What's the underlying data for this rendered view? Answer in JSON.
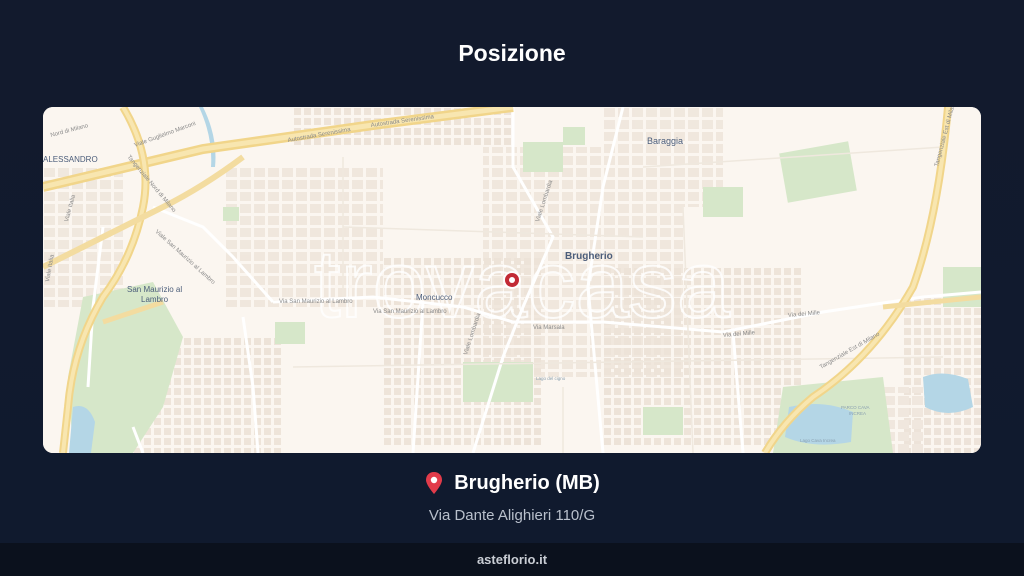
{
  "page": {
    "title": "Posizione"
  },
  "map": {
    "watermark": "trovacasa",
    "labels": {
      "alessandro": "ALESSANDRO",
      "baraggia": "Baraggia",
      "brugherio": "Brugherio",
      "moncucco": "Moncucco",
      "san_maurizio": "San Maurizio al",
      "san_maurizio_2": "Lambro",
      "parco": "PARCO CAVA",
      "parco_2": "INCREA",
      "lago_increa": "Lago Cava Increa",
      "lago_del_cigno": "Lago del cigno",
      "autostrada_1": "Autostrada Serenissima",
      "autostrada_2": "Autostrada Serenissima",
      "viale_marconi": "Viale Guglielmo Marconi",
      "nord_milano": "Nord di Milano",
      "tang_nord": "Tangenziale Nord di Milano",
      "viale_italia": "Viale Italia",
      "viale_italia_2": "Viale Italia",
      "viale_sm_lambro": "Viale San Maurizio al Lambro",
      "via_sm_lambro": "Via San Maurizio al Lambro",
      "via_sm_lambro_2": "Via San Maurizio al Lambro",
      "viale_lombardia": "Viale Lombardia",
      "viale_lombardia_2": "Viale Lombardia",
      "via_marsala": "Via Marsala",
      "via_dei_mille": "Via dei Mille",
      "via_dei_mille_2": "Via dei Mille",
      "tang_est": "Tangenziale Est di Milano",
      "tang_est_2": "Tangenziale Est di Milano"
    },
    "colors": {
      "background": "#fbf6f0",
      "motorway": "#f4d98a",
      "green": "#cfe3c4",
      "water": "#a9cfe0",
      "marker": "#c22a35"
    },
    "marker_icon": "location-marker-icon"
  },
  "location": {
    "pin_icon": "map-pin-icon",
    "place": "Brugherio (MB)",
    "address": "Via Dante Alighieri 110/G"
  },
  "footer": {
    "site": "asteflorio.it"
  }
}
